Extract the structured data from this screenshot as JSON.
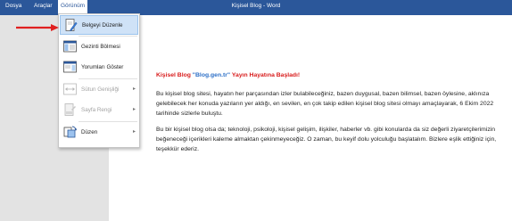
{
  "menu": {
    "file": "Dosya",
    "tools": "Araçlar",
    "view": "Görünüm"
  },
  "window_title": "Kişisel Blog - Word",
  "view_menu": {
    "items": [
      {
        "label": "Belgeyi Düzenle",
        "icon": "edit-document-icon",
        "enabled": true,
        "submenu": false
      },
      {
        "label": "Gezinti Bölmesi",
        "icon": "navigation-pane-icon",
        "enabled": true,
        "submenu": false
      },
      {
        "label": "Yorumları Göster",
        "icon": "show-comments-icon",
        "enabled": true,
        "submenu": false
      },
      {
        "label": "Sütun Genişliği",
        "icon": "column-width-icon",
        "enabled": false,
        "submenu": true
      },
      {
        "label": "Sayfa Rengi",
        "icon": "page-color-icon",
        "enabled": false,
        "submenu": true
      },
      {
        "label": "Düzen",
        "icon": "layout-icon",
        "enabled": true,
        "submenu": true
      }
    ]
  },
  "document": {
    "heading_prefix": "Kişisel Blog ",
    "heading_quoted": "\"Blog.gen.tr\"",
    "heading_suffix": " Yayın Hayatına Başladı!",
    "paragraphs": [
      "Bu kişisel blog sitesi, hayatın her parçasından izler bulabileceğiniz, bazen duygusal, bazen bilimsel, bazen öylesine, aklınıza gelebilecek her konuda yazıların yer aldığı, en sevilen, en çok takip edilen kişisel blog sitesi olmayı amaçlayarak, 6 Ekim 2022 tarihinde sizlerle buluştu.",
      "Bu bir kişisel blog olsa da; teknoloji, psikoloji, kişisel gelişim, ilişkiler, haberler vb. gibi konularda da siz değerli ziyaretçilerimizin beğeneceği içerikleri kaleme almaktan çekinmeyeceğiz. O zaman, bu keyif dolu yolculuğu başlatalım. Bizlere eşlik ettiğiniz için, teşekkür ederiz."
    ]
  },
  "colors": {
    "titlebar": "#2b579a",
    "heading": "#d81b1b",
    "link": "#2c6fc7",
    "highlight": "#cfe2f7",
    "annotation_arrow": "#e02020"
  }
}
